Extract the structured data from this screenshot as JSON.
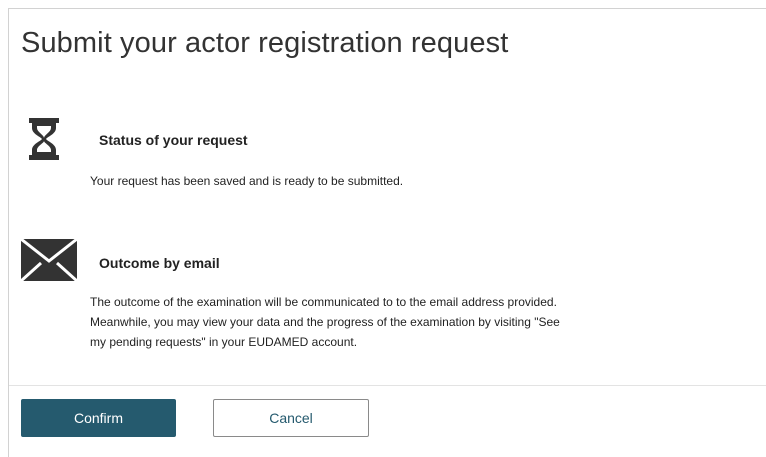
{
  "dialog": {
    "title": "Submit your actor registration request"
  },
  "status": {
    "icon": "hourglass-icon",
    "heading": "Status of your request",
    "text": "Your request has been saved and is ready to be submitted."
  },
  "outcome": {
    "icon": "envelope-icon",
    "heading": "Outcome by email",
    "lines": [
      "The outcome of the examination will be communicated to to the email address provided.",
      "Meanwhile, you may view your data and the progress of the examination by visiting \"See",
      "my pending requests\" in your EUDAMED account."
    ]
  },
  "actions": {
    "confirm_label": "Confirm",
    "cancel_label": "Cancel"
  },
  "colors": {
    "primary": "#255a6e",
    "icon": "#333333"
  }
}
